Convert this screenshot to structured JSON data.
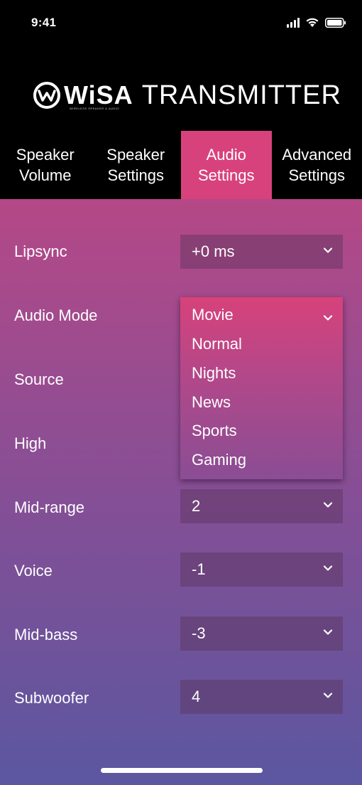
{
  "status_bar": {
    "time": "9:41",
    "icons": [
      "signal-icon",
      "wifi-icon",
      "battery-icon"
    ]
  },
  "header": {
    "brand": "WiSA",
    "title": "TRANSMITTER",
    "tagline": "WIRELESS SPEAKER & AUDIO"
  },
  "tabs": [
    {
      "line1": "Speaker",
      "line2": "Volume",
      "active": false
    },
    {
      "line1": "Speaker",
      "line2": "Settings",
      "active": false
    },
    {
      "line1": "Audio",
      "line2": "Settings",
      "active": true
    },
    {
      "line1": "Advanced",
      "line2": "Settings",
      "active": false
    }
  ],
  "settings": {
    "lipsync": {
      "label": "Lipsync",
      "value": "+0 ms"
    },
    "audio_mode": {
      "label": "Audio Mode",
      "value": "Movie"
    },
    "source": {
      "label": "Source"
    },
    "high": {
      "label": "High"
    },
    "mid_range": {
      "label": "Mid-range",
      "value": "2"
    },
    "voice": {
      "label": "Voice",
      "value": "-1"
    },
    "mid_bass": {
      "label": "Mid-bass",
      "value": "-3"
    },
    "subwoofer": {
      "label": "Subwoofer",
      "value": "4"
    }
  },
  "audio_mode_options": [
    "Movie",
    "Normal",
    "Nights",
    "News",
    "Sports",
    "Gaming"
  ],
  "colors": {
    "accent": "#d8427c",
    "header_bg": "#000000",
    "gradient_top": "#d6417a",
    "gradient_bottom": "#5b57a0"
  }
}
